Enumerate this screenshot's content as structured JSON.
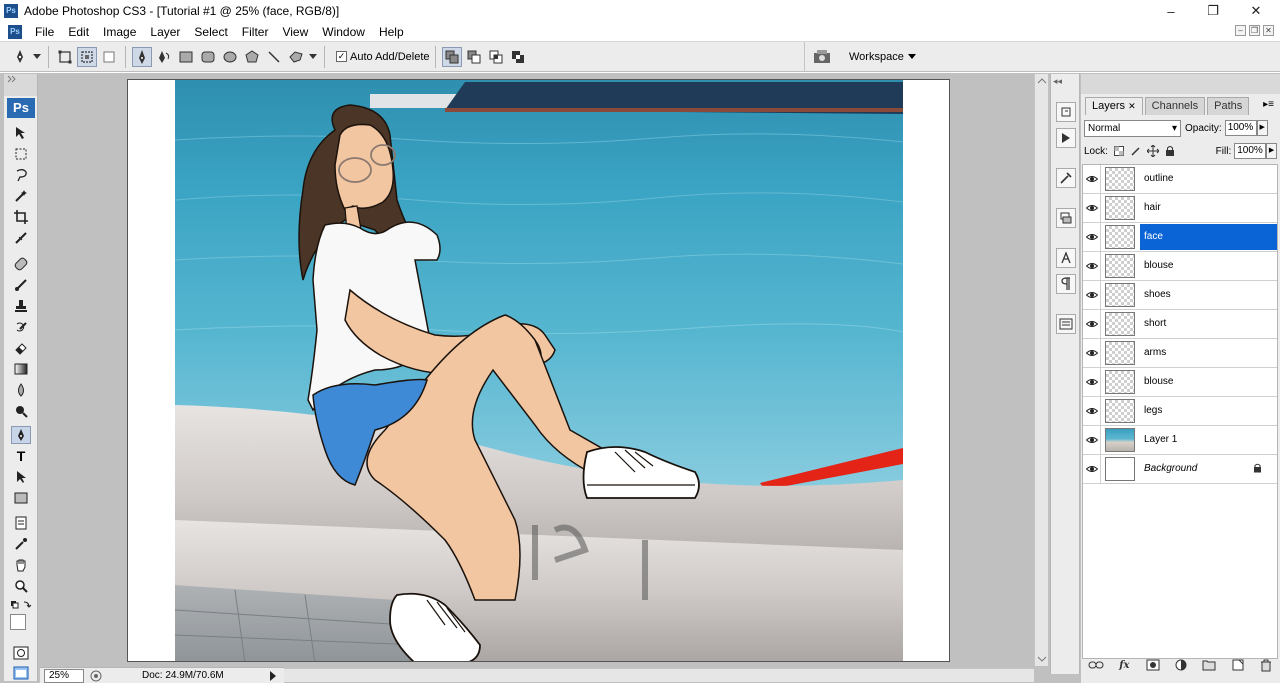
{
  "window": {
    "title": "Adobe Photoshop CS3 - [Tutorial #1 @ 25% (face, RGB/8)]",
    "app_icon": "Ps",
    "controls": {
      "minimize": "–",
      "restore": "❐",
      "close": "✕"
    }
  },
  "menu": {
    "items": [
      "File",
      "Edit",
      "Image",
      "Layer",
      "Select",
      "Filter",
      "View",
      "Window",
      "Help"
    ],
    "doc_controls": [
      "–",
      "❐",
      "✕"
    ]
  },
  "options": {
    "auto_add_delete": "Auto Add/Delete",
    "auto_add_checked": true,
    "workspace_label": "Workspace"
  },
  "toolbox": {
    "badge": "Ps",
    "type_tool_glyph": "T",
    "active_tool": "pen-tool"
  },
  "status": {
    "zoom": "25%",
    "doc_size": "Doc: 24.9M/70.6M"
  },
  "layers_panel": {
    "tabs": [
      "Layers",
      "Channels",
      "Paths"
    ],
    "active_tab": "Layers",
    "blend_mode": "Normal",
    "opacity_label": "Opacity:",
    "opacity_value": "100%",
    "lock_label": "Lock:",
    "fill_label": "Fill:",
    "fill_value": "100%",
    "layers": [
      {
        "name": "outline",
        "thumb": "transparent",
        "visible": true
      },
      {
        "name": "hair",
        "thumb": "transparent",
        "visible": true
      },
      {
        "name": "face",
        "thumb": "transparent",
        "visible": true,
        "selected": true
      },
      {
        "name": "blouse",
        "thumb": "transparent",
        "visible": true
      },
      {
        "name": "shoes",
        "thumb": "transparent",
        "visible": true
      },
      {
        "name": "short",
        "thumb": "transparent",
        "visible": true
      },
      {
        "name": "arms",
        "thumb": "transparent",
        "visible": true
      },
      {
        "name": "blouse",
        "thumb": "transparent",
        "visible": true
      },
      {
        "name": "legs",
        "thumb": "transparent",
        "visible": true
      },
      {
        "name": "Layer 1",
        "thumb": "photo",
        "visible": true
      },
      {
        "name": "Background",
        "thumb": "white",
        "visible": true,
        "locked": true
      }
    ]
  },
  "colors": {
    "selection_blue": "#0a64d6",
    "photoshop_blue": "#2a6ab2",
    "skin": "#f3c6a2",
    "hair": "#4a3526",
    "shorts": "#3e8ad6",
    "sea": "#3fa8c4",
    "red_rail": "#e32416"
  }
}
